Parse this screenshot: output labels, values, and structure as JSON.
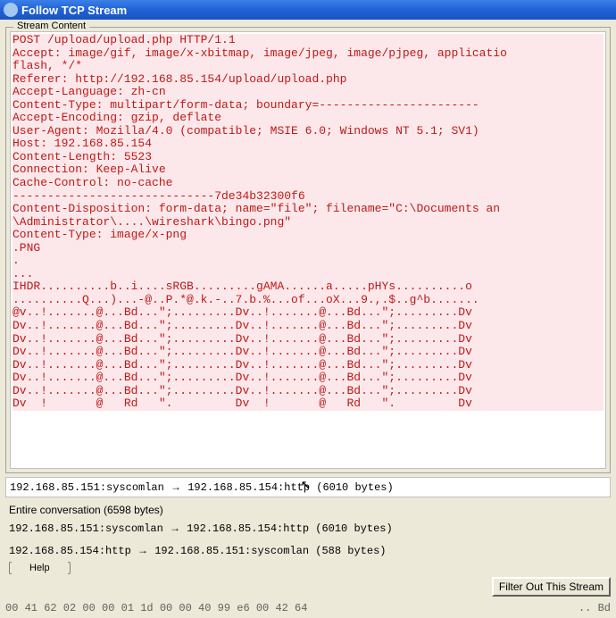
{
  "titlebar": {
    "title": "Follow TCP Stream"
  },
  "fieldset": {
    "legend": "Stream Content"
  },
  "http": {
    "line1": "POST /upload/upload.php HTTP/1.1",
    "line2": "Accept: image/gif, image/x-xbitmap, image/jpeg, image/pjpeg, applicatio",
    "line3": "flash, */*",
    "line4": "Referer: http://192.168.85.154/upload/upload.php",
    "line5": "Accept-Language: zh-cn",
    "line6": "Content-Type: multipart/form-data; boundary=-----------------------",
    "line7": "Accept-Encoding: gzip, deflate",
    "line8": "User-Agent: Mozilla/4.0 (compatible; MSIE 6.0; Windows NT 5.1; SV1)",
    "line9": "Host: 192.168.85.154",
    "line10": "Content-Length: 5523",
    "line11": "Connection: Keep-Alive",
    "line12": "Cache-Control: no-cache",
    "line13": "",
    "line14": "-----------------------------7de34b32300f6",
    "line15": "Content-Disposition: form-data; name=\"file\"; filename=\"C:\\Documents an",
    "line16": "\\Administrator\\....\\wireshark\\bingo.png\"",
    "line17": "Content-Type: image/x-png",
    "line18": "",
    "line19": ".PNG",
    "line20": ".",
    "line21": "...",
    "line22": "IHDR..........b..i....sRGB.........gAMA......a.....pHYs..........o",
    "line23": "..........Q...)...-@..P.*@.k.-..7.b.%...of...oX...9.,.$..g^b.......",
    "line24": "@v..!.......@...Bd...\";.........Dv..!.......@...Bd...\";.........Dv",
    "line25": "Dv..!.......@...Bd...\";.........Dv..!.......@...Bd...\";.........Dv",
    "line26": "Dv..!.......@...Bd...\";.........Dv..!.......@...Bd...\";.........Dv",
    "line27": "Dv..!.......@...Bd...\";.........Dv..!.......@...Bd...\";.........Dv",
    "line28": "Dv..!.......@...Bd...\";.........Dv..!.......@...Bd...\";.........Dv",
    "line29": "Dv..!.......@...Bd...\";.........Dv..!.......@...Bd...\";.........Dv",
    "line30": "Dv..!.......@...Bd...\";.........Dv..!.......@...Bd...\";.........Dv",
    "line31": "Dv  !       @   Rd   \".         Dv  !       @   Rd   \".         Dv"
  },
  "dropdown1": {
    "text_pre": "192.168.85.151:syscomlan ",
    "arrow": "→",
    "text_post": " 192.168.85.154:http (6010 bytes)"
  },
  "info": {
    "conversation": "Entire conversation (6598 bytes)"
  },
  "row3": {
    "text_pre": "192.168.85.151:syscomlan ",
    "arrow": "→",
    "text_post": " 192.168.85.154:http (6010 bytes)"
  },
  "row4": {
    "text_pre": "192.168.85.154:http ",
    "arrow": "→",
    "text_post": " 192.168.85.151:syscomlan (588 bytes)"
  },
  "buttons": {
    "help": "Help",
    "filter": "Filter Out This Stream"
  },
  "status": {
    "left": "00 41 62 02 00 00 01 1d  00 00 40 99 e6 00 42 64",
    "right": "..         Bd"
  }
}
